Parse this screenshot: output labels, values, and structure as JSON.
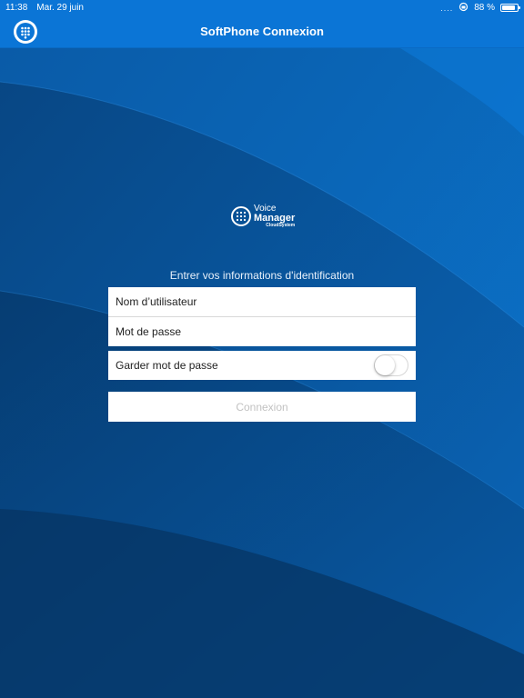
{
  "status_bar": {
    "time": "11:38",
    "date": "Mar. 29 juin",
    "signal": "....",
    "battery_text": "88 %",
    "battery_level": 0.88
  },
  "nav": {
    "title": "SoftPhone Connexion",
    "logo_icon": "dialpad-globe-icon"
  },
  "brand": {
    "line1": "Voice",
    "line2": "Manager",
    "line3": "CloudSystem"
  },
  "form": {
    "prompt": "Entrer vos informations d'identification",
    "username_placeholder": "Nom d’utilisateur",
    "password_placeholder": "Mot de passe",
    "remember_label": "Garder mot de passe",
    "remember_on": false,
    "submit_label": "Connexion"
  },
  "colors": {
    "bar": "#0b75d6",
    "background": "#0a4f92",
    "disabled_text": "#c2c2c2"
  }
}
